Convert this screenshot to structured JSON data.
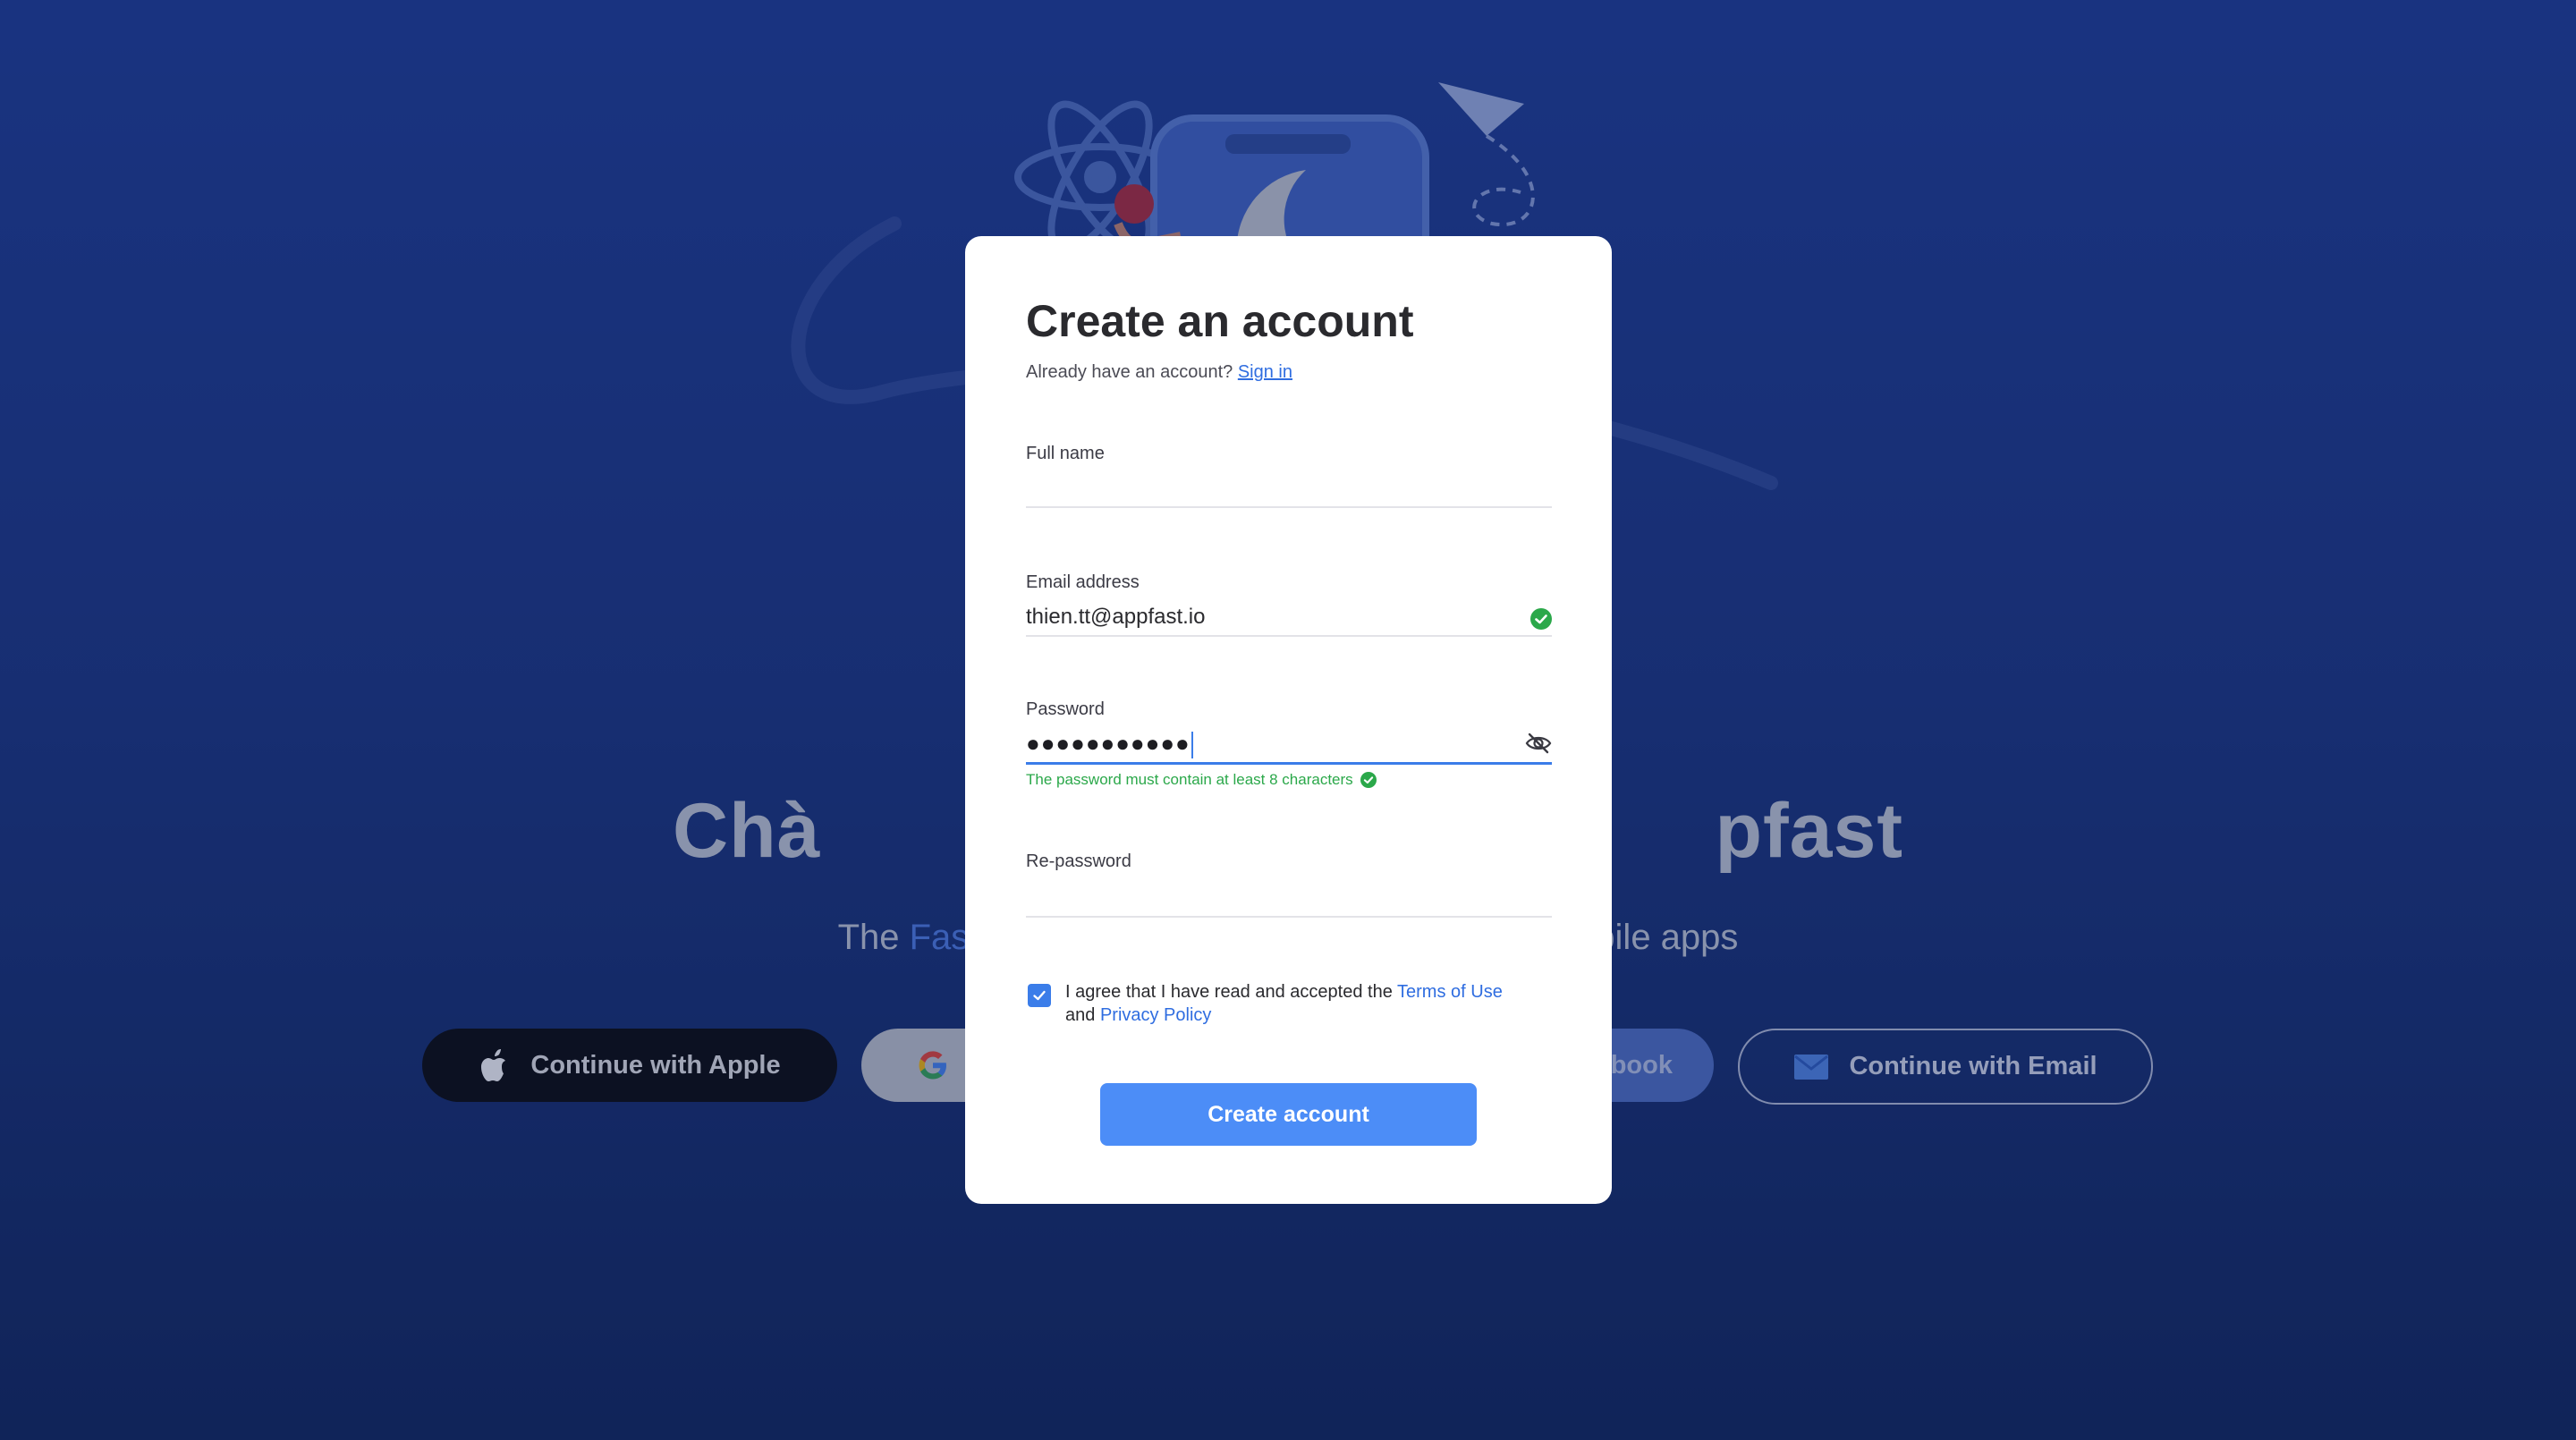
{
  "hero": {
    "title_left": "Chà",
    "title_right": "pfast",
    "sub_left": "The ",
    "sub_accent": "Fas",
    "sub_right": "bile apps"
  },
  "social": {
    "apple": "Continue with Apple",
    "facebook": "ebook",
    "email": "Continue with Email"
  },
  "modal": {
    "title": "Create an account",
    "already_text": "Already have an account? ",
    "sign_in": "Sign in",
    "full_name_label": "Full name",
    "full_name_value": "",
    "email_label": "Email address",
    "email_value": "thien.tt@appfast.io",
    "password_label": "Password",
    "password_value": "●●●●●●●●●●●",
    "password_helper": "The password must contain at least 8 characters",
    "repassword_label": "Re-password",
    "repassword_value": "",
    "agree_text": "I agree that I have read and accepted the ",
    "terms": "Terms of Use",
    "and": "and ",
    "privacy": "Privacy Policy",
    "create_button": "Create account"
  },
  "colors": {
    "accent": "#4c8df7",
    "link": "#2f6de0",
    "success": "#2ba84a",
    "background_top": "#1a3a96",
    "background_bottom": "#0c2259"
  }
}
